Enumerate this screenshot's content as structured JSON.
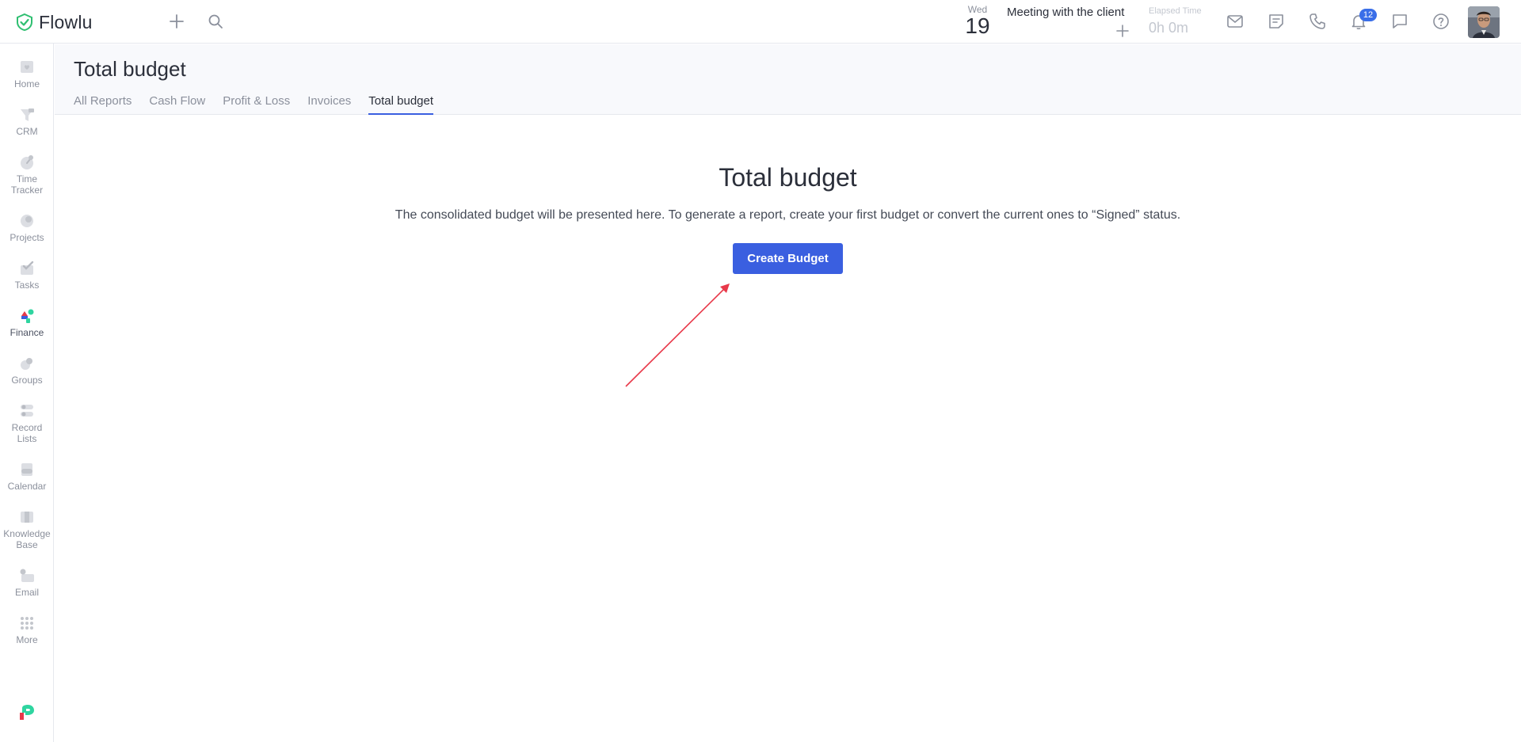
{
  "app": {
    "name": "Flowlu"
  },
  "topbar": {
    "date": {
      "weekday": "Wed",
      "day": "19"
    },
    "event": {
      "title": "Meeting with the client"
    },
    "elapsed": {
      "label": "Elapsed Time",
      "value": "0h 0m"
    },
    "notifications_count": "12",
    "icons": [
      "add-icon",
      "search-icon",
      "mail-icon",
      "notes-icon",
      "phone-icon",
      "bell-icon",
      "chat-icon",
      "help-icon"
    ]
  },
  "sidebar": {
    "items": [
      {
        "label": "Home",
        "icon": "home-icon"
      },
      {
        "label": "CRM",
        "icon": "crm-icon"
      },
      {
        "label": "Time\nTracker",
        "icon": "timer-icon"
      },
      {
        "label": "Projects",
        "icon": "projects-icon"
      },
      {
        "label": "Tasks",
        "icon": "tasks-icon"
      },
      {
        "label": "Finance",
        "icon": "finance-icon"
      },
      {
        "label": "Groups",
        "icon": "groups-icon"
      },
      {
        "label": "Record\nLists",
        "icon": "record-lists-icon"
      },
      {
        "label": "Calendar",
        "icon": "calendar-icon"
      },
      {
        "label": "Knowledge\nBase",
        "icon": "knowledge-base-icon"
      },
      {
        "label": "Email",
        "icon": "email-icon"
      },
      {
        "label": "More",
        "icon": "more-icon"
      }
    ],
    "active": "Finance"
  },
  "page": {
    "title": "Total budget",
    "tabs": [
      {
        "label": "All Reports"
      },
      {
        "label": "Cash Flow"
      },
      {
        "label": "Profit & Loss"
      },
      {
        "label": "Invoices"
      },
      {
        "label": "Total budget"
      }
    ],
    "active_tab": "Total budget"
  },
  "empty_state": {
    "title": "Total budget",
    "description": "The consolidated budget will be presented here. To generate a report, create your first budget or convert the current ones to “Signed” status.",
    "button_label": "Create Budget"
  },
  "colors": {
    "accent": "#3a5fe0",
    "badge": "#3a6ee8",
    "brand_green": "#2fbf71",
    "annotation_arrow": "#e8394a"
  }
}
